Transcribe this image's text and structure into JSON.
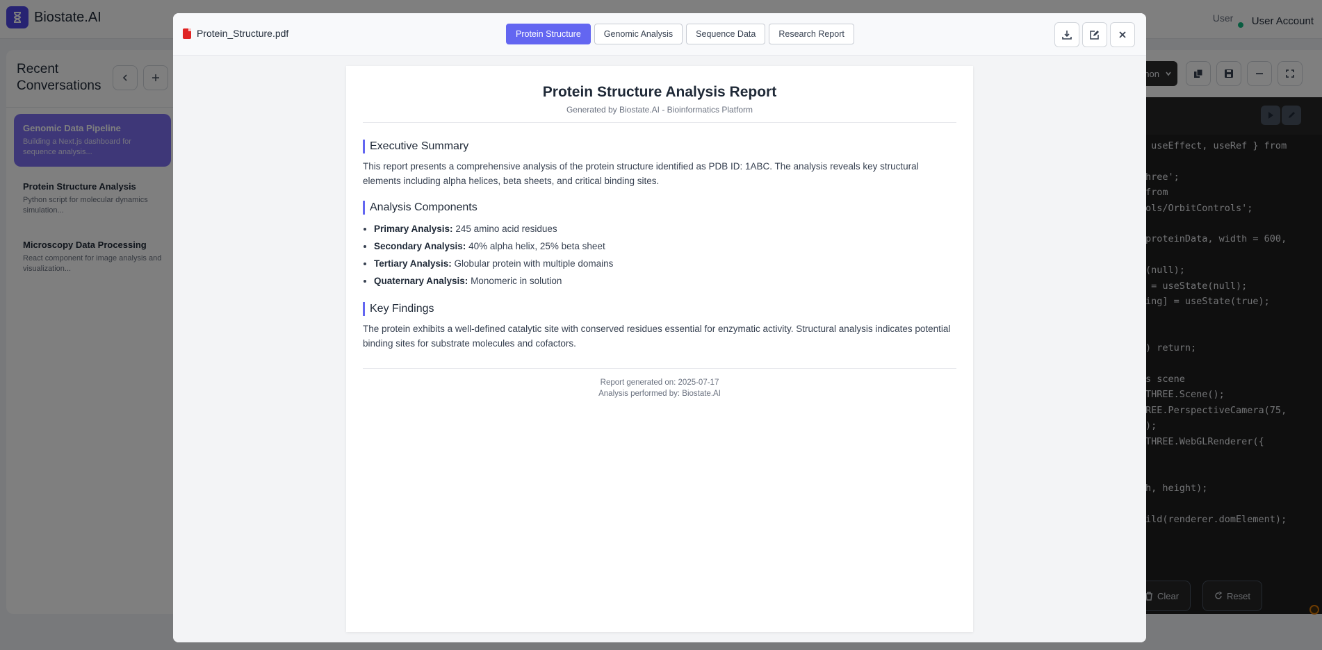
{
  "app": {
    "name": "Biostate.AI",
    "user_label": "User Account",
    "avatar_alt": "User"
  },
  "sidebar": {
    "title": "Recent Conversations",
    "conversations": [
      {
        "title": "Genomic Data Pipeline",
        "subtitle": "Building a Next.js dashboard for sequence analysis...",
        "active": true
      },
      {
        "title": "Protein Structure Analysis",
        "subtitle": "Python script for molecular dynamics simulation...",
        "active": false
      },
      {
        "title": "Microscopy Data Processing",
        "subtitle": "React component for image analysis and visualization...",
        "active": false
      }
    ]
  },
  "code_panel": {
    "language": "Python",
    "lines": [
      " useEffect, useRef } from",
      "",
      "hree';",
      "from",
      "ols/OrbitControls';",
      "",
      "proteinData, width = 600,",
      "",
      "(null);",
      " = useState(null);",
      "ing] = useState(true);",
      "",
      "",
      ") return;",
      "",
      "s scene",
      "THREE.Scene();",
      "REE.PerspectiveCamera(75,",
      ");",
      "THREE.WebGLRenderer({",
      "",
      "",
      "h, height);",
      "",
      "ild(renderer.domElement);"
    ],
    "clear_label": "Clear",
    "reset_label": "Reset"
  },
  "modal": {
    "file_name": "Protein_Structure.pdf",
    "tabs": [
      {
        "label": "Protein Structure",
        "active": true
      },
      {
        "label": "Genomic Analysis",
        "active": false
      },
      {
        "label": "Sequence Data",
        "active": false
      },
      {
        "label": "Research Report",
        "active": false
      }
    ]
  },
  "report": {
    "title": "Protein Structure Analysis Report",
    "subtitle": "Generated by Biostate.AI - Bioinformatics Platform",
    "exec_heading": "Executive Summary",
    "exec_text": "This report presents a comprehensive analysis of the protein structure identified as PDB ID: 1ABC. The analysis reveals key structural elements including alpha helices, beta sheets, and critical binding sites.",
    "components_heading": "Analysis Components",
    "components": [
      {
        "label": "Primary Analysis:",
        "value": " 245 amino acid residues"
      },
      {
        "label": "Secondary Analysis:",
        "value": " 40% alpha helix, 25% beta sheet"
      },
      {
        "label": "Tertiary Analysis:",
        "value": " Globular protein with multiple domains"
      },
      {
        "label": "Quaternary Analysis:",
        "value": " Monomeric in solution"
      }
    ],
    "findings_heading": "Key Findings",
    "findings_text": "The protein exhibits a well-defined catalytic site with conserved residues essential for enzymatic activity. Structural analysis indicates potential binding sites for substrate molecules and cofactors.",
    "footer_date": "Report generated on: 2025-07-17",
    "footer_by": "Analysis performed by: Biostate.AI"
  }
}
